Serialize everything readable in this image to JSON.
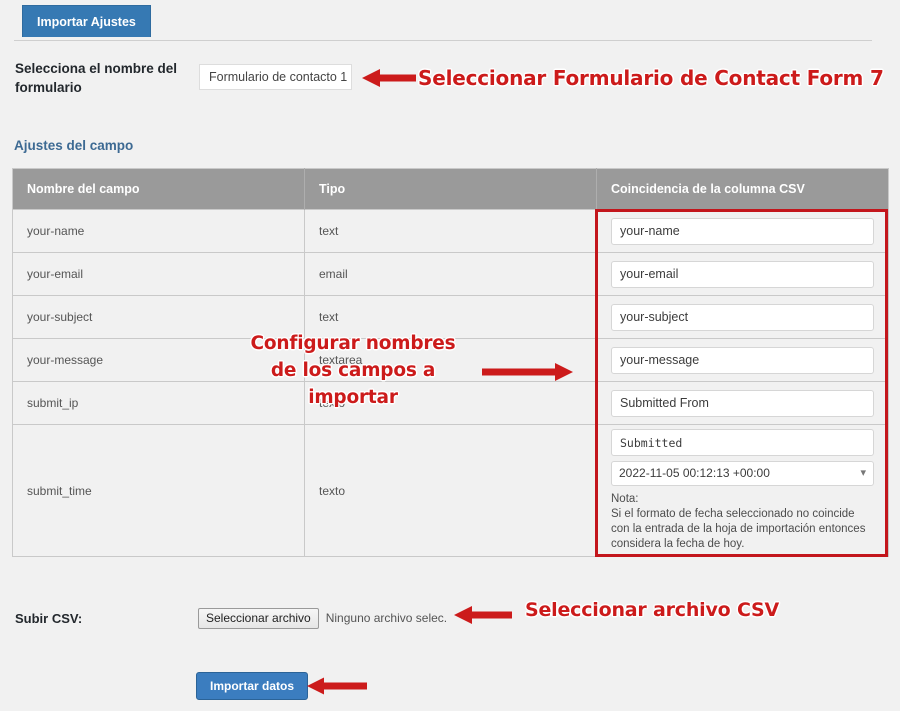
{
  "colors": {
    "accent_blue": "#3679b3",
    "button_blue": "#3b7dbf",
    "annotation_red": "#cc1b1b",
    "highlight_box_red": "#c3161c",
    "table_header_gray": "#9a9a9a",
    "page_background": "#f1f1f1",
    "heading_blue": "#3d6a93"
  },
  "tabs": [
    {
      "label": "Importar Ajustes",
      "active": true
    }
  ],
  "form_selector": {
    "label": "Selecciona el nombre del formulario",
    "selected_value": "Formulario de contacto 1",
    "options": [
      "Formulario de contacto 1"
    ]
  },
  "section": {
    "heading": "Ajustes del campo"
  },
  "table": {
    "columns": [
      "Nombre del campo",
      "Tipo",
      "Coincidencia de la columna CSV"
    ],
    "rows": [
      {
        "field_name": "your-name",
        "type": "text",
        "csv_value": "your-name"
      },
      {
        "field_name": "your-email",
        "type": "email",
        "csv_value": "your-email"
      },
      {
        "field_name": "your-subject",
        "type": "text",
        "csv_value": "your-subject"
      },
      {
        "field_name": "your-message",
        "type": "textarea",
        "csv_value": "your-message"
      },
      {
        "field_name": "submit_ip",
        "type": "texto",
        "csv_value": "Submitted From"
      },
      {
        "field_name": "submit_time",
        "type": "texto",
        "csv_value": "Submitted"
      }
    ],
    "date_format": {
      "selected_value": "2022-11-05 00:12:13 +00:00",
      "options": [
        "2022-11-05 00:12:13 +00:00"
      ],
      "chevron": "chevron-down-icon"
    },
    "note": {
      "title": "Nota:",
      "body": "Si el formato de fecha seleccionado no coincide con la entrada de la hoja de importación entonces considera la fecha de hoy."
    }
  },
  "upload": {
    "label": "Subir CSV:",
    "button_label": "Seleccionar archivo",
    "file_status": "Ninguno archivo selec."
  },
  "submit": {
    "label": "Importar datos"
  },
  "annotations": {
    "form": "Seleccionar Formulario de Contact Form 7",
    "fields": "Configurar nombres de los campos a importar",
    "file": "Seleccionar archivo CSV"
  }
}
